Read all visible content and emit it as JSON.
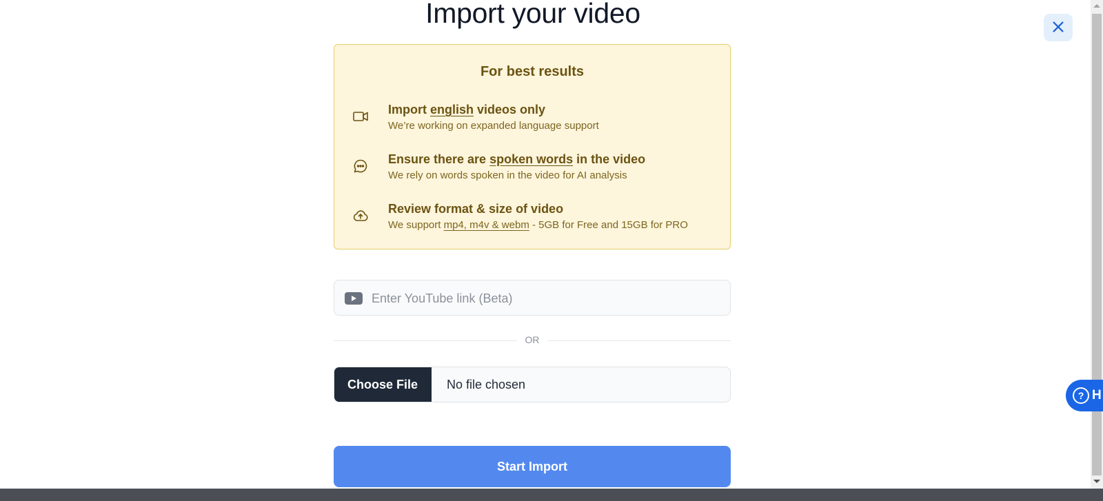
{
  "page": {
    "title": "Import your video"
  },
  "tips": {
    "heading": "For best results",
    "items": [
      {
        "icon": "video-camera-icon",
        "title_pre": "Import ",
        "title_link": "english",
        "title_post": " videos only",
        "subtitle_pre": "We’re working on expanded language support",
        "subtitle_link": "",
        "subtitle_post": ""
      },
      {
        "icon": "chat-bubble-icon",
        "title_pre": "Ensure there are ",
        "title_link": "spoken words",
        "title_post": " in the video",
        "subtitle_pre": "We rely on words spoken in the video for AI analysis",
        "subtitle_link": "",
        "subtitle_post": ""
      },
      {
        "icon": "cloud-upload-icon",
        "title_pre": "Review format & size of video",
        "title_link": "",
        "title_post": "",
        "subtitle_pre": "We support ",
        "subtitle_link": "mp4, m4v & webm",
        "subtitle_post": " - 5GB for Free and 15GB for PRO"
      }
    ]
  },
  "youtube": {
    "placeholder": "Enter YouTube link (Beta)",
    "value": ""
  },
  "divider": {
    "label": "OR"
  },
  "file": {
    "button_label": "Choose File",
    "status": "No file chosen"
  },
  "actions": {
    "start_label": "Start Import"
  },
  "help": {
    "label": "H",
    "icon": "question-circle-icon"
  },
  "colors": {
    "primary": "#5389ef",
    "tips_bg": "#fdf5dc",
    "tips_border": "#e7cf6a",
    "tips_text": "#6b5312",
    "dark_button": "#1f2937",
    "help_blue": "#1a66e6"
  }
}
